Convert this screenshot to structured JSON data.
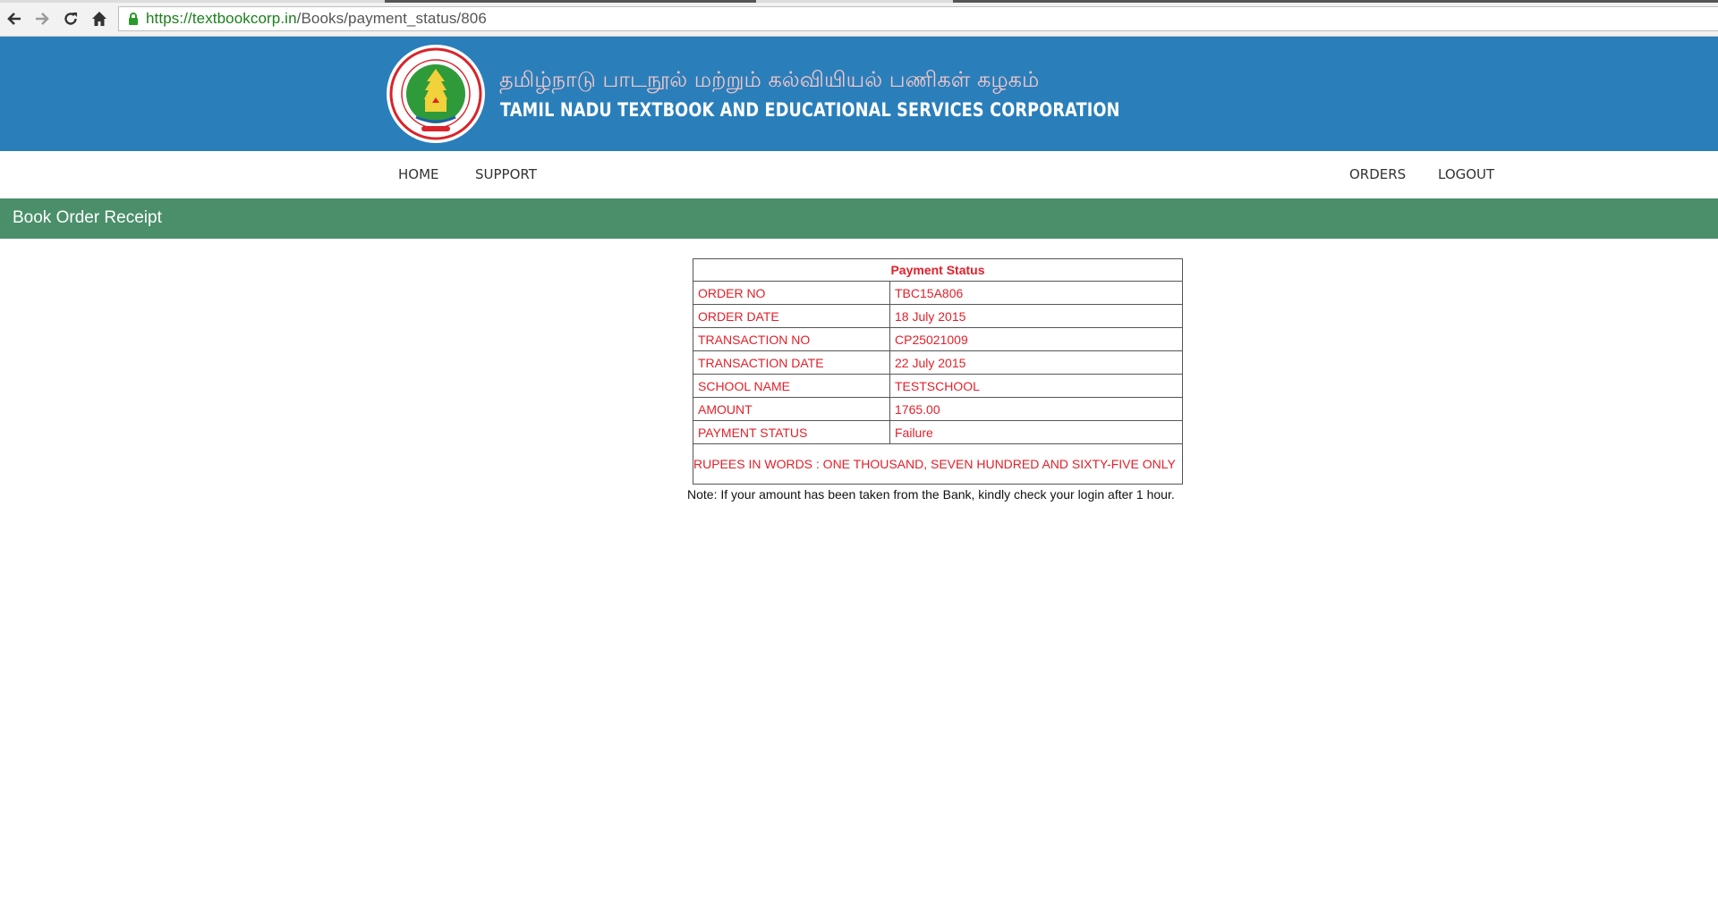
{
  "browser": {
    "url_scheme": "https://",
    "url_host": "textbookcorp.in",
    "url_path": "/Books/payment_status/806"
  },
  "header": {
    "title_tamil": "தமிழ்நாடு பாடநூல் மற்றும் கல்வியியல் பணிகள் கழகம்",
    "title_english": "TAMIL NADU TEXTBOOK AND EDUCATIONAL SERVICES CORPORATION",
    "logo_icon": "tamil-nadu-emblem-icon"
  },
  "nav": {
    "home": "HOME",
    "support": "SUPPORT",
    "orders": "ORDERS",
    "logout": "LOGOUT"
  },
  "page_title": "Book Order Receipt",
  "receipt": {
    "heading": "Payment Status",
    "rows": [
      {
        "label": "ORDER NO",
        "value": "TBC15A806"
      },
      {
        "label": "ORDER DATE",
        "value": "18 July 2015"
      },
      {
        "label": "TRANSACTION NO",
        "value": "CP25021009"
      },
      {
        "label": "TRANSACTION DATE",
        "value": "22 July 2015"
      },
      {
        "label": "SCHOOL NAME",
        "value": "TESTSCHOOL"
      },
      {
        "label": "AMOUNT",
        "value": "1765.00"
      },
      {
        "label": "PAYMENT STATUS",
        "value": "Failure"
      }
    ],
    "rupees_in_words": "RUPEES IN WORDS : ONE THOUSAND, SEVEN HUNDRED AND SIXTY-FIVE ONLY"
  },
  "note": "Note: If your amount has been taken from the Bank, kindly check your login after 1 hour.",
  "colors": {
    "header_bg": "#2a7fbb",
    "title_band_bg": "#4a8f6a",
    "receipt_text": "#e3202a"
  }
}
